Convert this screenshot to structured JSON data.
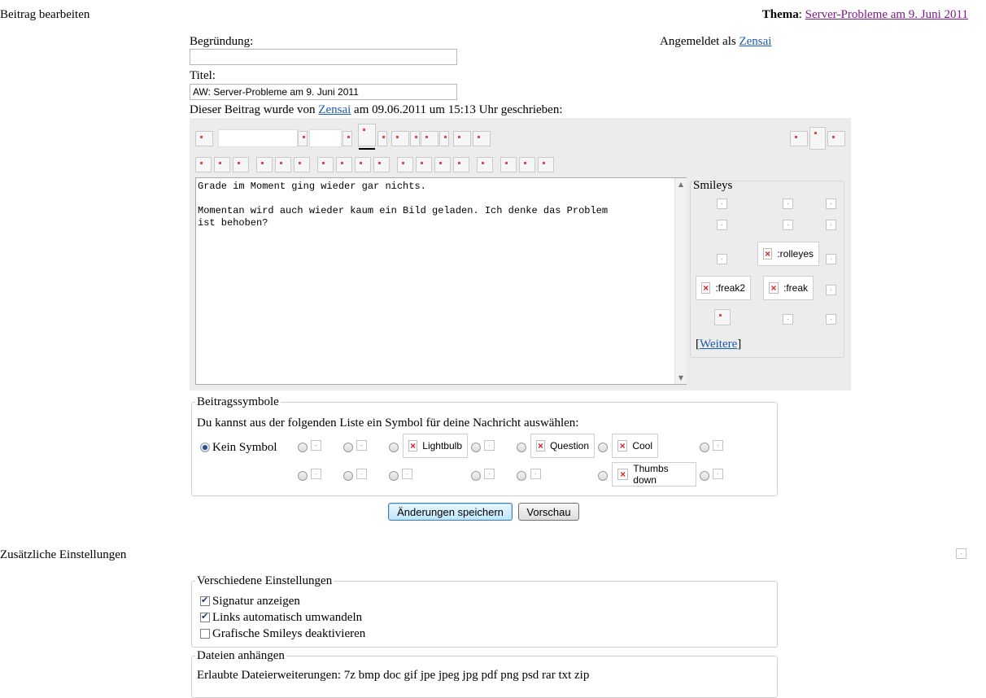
{
  "page": {
    "title": "Beitrag bearbeiten",
    "thema_label": "Thema",
    "thema_link": "Server-Probleme am 9. Juni 2011",
    "logged_in_prefix": "Angemeldet als",
    "logged_in_user": "Zensai"
  },
  "form": {
    "reason_label": "Begründung:",
    "reason_value": "",
    "title_label": "Titel:",
    "title_value": "AW: Server-Probleme am 9. Juni 2011",
    "written_prefix": "Dieser Beitrag wurde von",
    "written_user": "Zensai",
    "written_suffix": "am 09.06.2011 um 15:13 Uhr geschrieben:",
    "message": "Grade im Moment ging wieder gar nichts.\n\nMomentan wird auch wieder kaum ein Bild geladen. Ich denke das Problem\nist behoben?"
  },
  "smileys": {
    "heading": "Smileys",
    "rolleyes": ":rolleyes",
    "freak2": ":freak2",
    "freak": ":freak",
    "more_open": "[",
    "more_link": "Weitere",
    "more_close": "]"
  },
  "post_icons": {
    "legend": "Beitragssymbole",
    "intro": "Du kannst aus der folgenden Liste ein Symbol für deine Nachricht auswählen:",
    "none_label": "Kein Symbol",
    "lightbulb": "Lightbulb",
    "question": "Question",
    "cool": "Cool",
    "thumbs_down": "Thumbs down"
  },
  "buttons": {
    "save": "Änderungen speichern",
    "preview": "Vorschau"
  },
  "extra": {
    "heading": "Zusätzliche Einstellungen",
    "misc_legend": "Verschiedene Einstellungen",
    "show_signature": "Signatur anzeigen",
    "auto_links": "Links automatisch umwandeln",
    "disable_smileys": "Grafische Smileys deaktivieren",
    "attach_legend": "Dateien anhängen",
    "allowed_ext": "Erlaubte Dateierweiterungen: 7z bmp doc gif jpe jpeg jpg pdf png psd rar txt zip"
  },
  "state": {
    "show_signature": true,
    "auto_links": true,
    "disable_smileys": false,
    "selected_icon": "none"
  }
}
